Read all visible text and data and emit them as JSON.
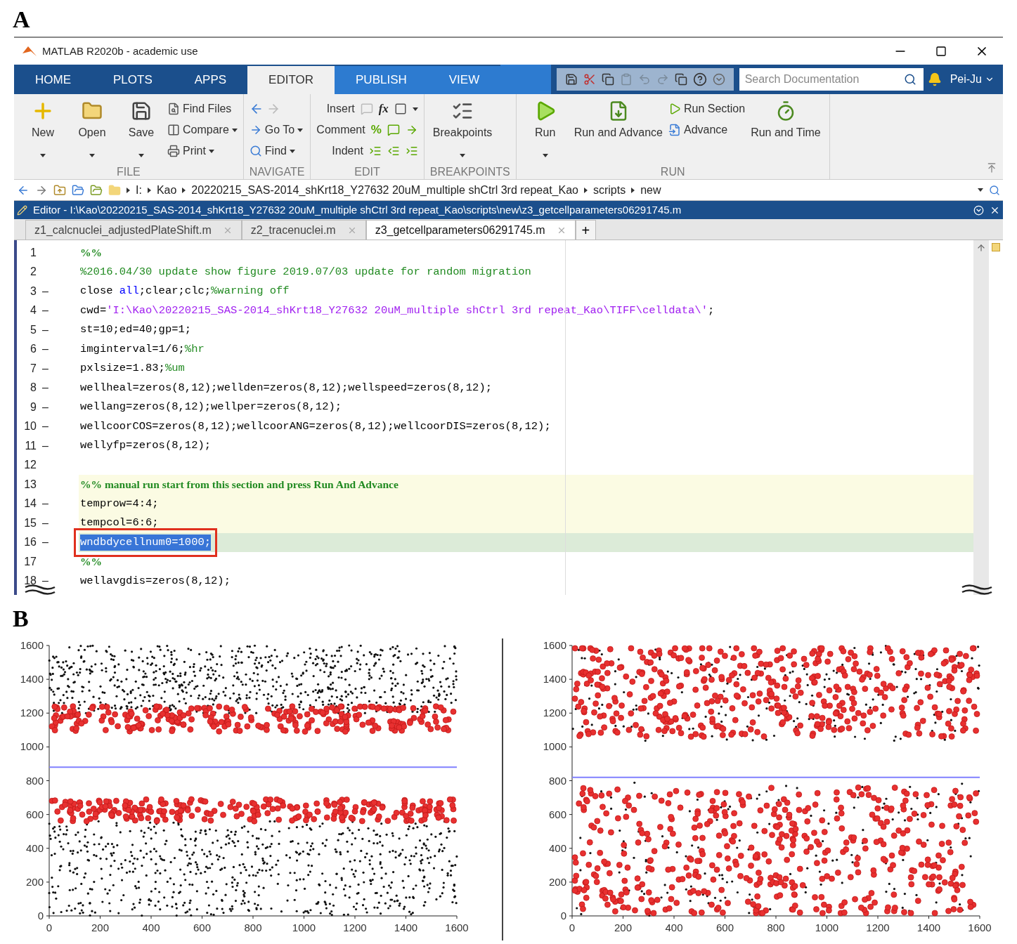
{
  "panel_a": {
    "label": "A"
  },
  "window": {
    "title": "MATLAB R2020b - academic use"
  },
  "tabs": [
    {
      "label": "HOME",
      "selected": false
    },
    {
      "label": "PLOTS",
      "selected": false
    },
    {
      "label": "APPS",
      "selected": false
    },
    {
      "label": "EDITOR",
      "selected": true
    },
    {
      "label": "PUBLISH",
      "selected": false
    },
    {
      "label": "VIEW",
      "selected": false
    }
  ],
  "search": {
    "placeholder": "Search Documentation"
  },
  "user": {
    "name": "Pei-Ju"
  },
  "ribbon": [
    {
      "title": "FILE",
      "columns": [
        {
          "kind": "large",
          "label": "New",
          "dropdown": true
        },
        {
          "kind": "large",
          "label": "Open",
          "dropdown": true
        },
        {
          "kind": "large",
          "label": "Save",
          "dropdown": true
        },
        {
          "kind": "stack",
          "items": [
            {
              "kind": "command",
              "label": "Find Files",
              "dropdown": false
            },
            {
              "kind": "command",
              "label": "Compare",
              "dropdown": true
            },
            {
              "kind": "command",
              "label": "Print",
              "dropdown": true
            }
          ]
        }
      ]
    },
    {
      "title": "NAVIGATE",
      "columns": [
        {
          "kind": "stack",
          "items": [
            {
              "kind": "nav-arrows"
            },
            {
              "kind": "command",
              "label": "Go To",
              "dropdown": true
            },
            {
              "kind": "command",
              "label": "Find",
              "dropdown": true
            }
          ]
        }
      ]
    },
    {
      "title": "EDIT",
      "columns": [
        {
          "kind": "stack",
          "items": [
            {
              "kind": "edit-row",
              "label": "Insert",
              "glyph": "fx",
              "dropdown": true
            },
            {
              "kind": "edit-row",
              "label": "Comment",
              "glyph": "%",
              "dropdown": false
            },
            {
              "kind": "edit-row",
              "label": "Indent",
              "dropdown": false
            }
          ]
        }
      ]
    },
    {
      "title": "BREAKPOINTS",
      "columns": [
        {
          "kind": "large",
          "label": "Breakpoints",
          "dropdown": true
        }
      ]
    },
    {
      "title": "RUN",
      "columns": [
        {
          "kind": "large",
          "label": "Run",
          "dropdown": true
        },
        {
          "kind": "large",
          "label": "Run and Advance",
          "dropdown": false
        },
        {
          "kind": "stack",
          "items": [
            {
              "kind": "command",
              "label": "Run Section",
              "dropdown": false
            },
            {
              "kind": "command",
              "label": "Advance",
              "dropdown": false
            }
          ]
        },
        {
          "kind": "large",
          "label": "Run and Time",
          "dropdown": false
        }
      ]
    }
  ],
  "address_bar": {
    "path": [
      "I:",
      "Kao",
      "20220215_SAS-2014_shKrt18_Y27632 20uM_multiple shCtrl 3rd repeat_Kao",
      "scripts",
      "new"
    ]
  },
  "editor": {
    "title": "Editor - I:\\Kao\\20220215_SAS-2014_shKrt18_Y27632 20uM_multiple shCtrl 3rd repeat_Kao\\scripts\\new\\z3_getcellparameters06291745.m",
    "file_tabs": [
      {
        "label": "z1_calcnuclei_adjustedPlateShift.m",
        "selected": false
      },
      {
        "label": "z2_tracenuclei.m",
        "selected": false
      },
      {
        "label": "z3_getcellparameters06291745.m",
        "selected": true
      }
    ],
    "new_tab": "+",
    "lines": [
      {
        "number": "1",
        "section": false,
        "current": false,
        "segments": [
          {
            "kind": "section",
            "text": "%%"
          }
        ]
      },
      {
        "number": "2",
        "section": false,
        "current": false,
        "segments": [
          {
            "kind": "comment",
            "text": "%2016.04/30 update show figure 2019.07/03 update for random migration"
          }
        ]
      },
      {
        "number": "3",
        "dash": "–",
        "section": false,
        "current": false,
        "segments": [
          {
            "kind": "code",
            "text": "close "
          },
          {
            "kind": "keyword",
            "text": "all"
          },
          {
            "kind": "code",
            "text": ";clear;clc;"
          },
          {
            "kind": "comment",
            "text": "%warning off"
          }
        ]
      },
      {
        "number": "4",
        "dash": "–",
        "section": false,
        "current": false,
        "segments": [
          {
            "kind": "code",
            "text": "cwd="
          },
          {
            "kind": "string",
            "text": "'I:\\Kao\\20220215_SAS-2014_shKrt18_Y27632 20uM_multiple shCtrl 3rd repeat_Kao\\TIFF\\celldata\\'"
          },
          {
            "kind": "code",
            "text": ";"
          }
        ]
      },
      {
        "number": "5",
        "dash": "–",
        "section": false,
        "current": false,
        "segments": [
          {
            "kind": "code",
            "text": "st=10;ed=40;gp=1;"
          }
        ]
      },
      {
        "number": "6",
        "dash": "–",
        "section": false,
        "current": false,
        "segments": [
          {
            "kind": "code",
            "text": "imginterval=1/6;"
          },
          {
            "kind": "comment",
            "text": "%hr"
          }
        ]
      },
      {
        "number": "7",
        "dash": "–",
        "section": false,
        "current": false,
        "segments": [
          {
            "kind": "code",
            "text": "pxlsize=1.83;"
          },
          {
            "kind": "comment",
            "text": "%um"
          }
        ]
      },
      {
        "number": "8",
        "dash": "–",
        "section": false,
        "current": false,
        "segments": [
          {
            "kind": "code",
            "text": "wellheal=zeros(8,12);wellden=zeros(8,12);wellspeed=zeros(8,12);"
          }
        ]
      },
      {
        "number": "9",
        "dash": "–",
        "section": false,
        "current": false,
        "segments": [
          {
            "kind": "code",
            "text": "wellang=zeros(8,12);wellper=zeros(8,12);"
          }
        ]
      },
      {
        "number": "10",
        "dash": "–",
        "section": false,
        "current": false,
        "segments": [
          {
            "kind": "code",
            "text": "wellcoorCOS=zeros(8,12);wellcoorANG=zeros(8,12);wellcoorDIS=zeros(8,12);"
          }
        ]
      },
      {
        "number": "11",
        "dash": "–",
        "section": false,
        "current": false,
        "segments": [
          {
            "kind": "code",
            "text": "wellyfp=zeros(8,12);"
          }
        ]
      },
      {
        "number": "12",
        "section": false,
        "current": false
      },
      {
        "number": "13",
        "section": true,
        "current": false,
        "segments": [
          {
            "kind": "section",
            "text": "%% manual run start from this section and press Run And Advance"
          }
        ]
      },
      {
        "number": "14",
        "dash": "–",
        "section": true,
        "current": false,
        "segments": [
          {
            "kind": "code",
            "text": "temprow=4:4;"
          }
        ]
      },
      {
        "number": "15",
        "dash": "–",
        "section": true,
        "current": false,
        "segments": [
          {
            "kind": "code",
            "text": "tempcol=6:6;"
          }
        ]
      },
      {
        "number": "16",
        "dash": "–",
        "section": true,
        "current": true,
        "segments": [
          {
            "kind": "code",
            "text": "wndbdycellnum0=1000;",
            "selected": true
          }
        ]
      },
      {
        "number": "17",
        "section": false,
        "current": false,
        "segments": [
          {
            "kind": "section",
            "text": "%%"
          }
        ]
      },
      {
        "number": "18",
        "dash": "–",
        "section": false,
        "current": false,
        "segments": [
          {
            "kind": "code",
            "text": "wellavgdis=zeros(8,12);"
          }
        ]
      }
    ]
  },
  "panel_b": {
    "label": "B",
    "plots": [
      {
        "kind": "edge-band",
        "x_ticks": [
          "0",
          "200",
          "400",
          "600",
          "800",
          "1000",
          "1200",
          "1400",
          "1600"
        ],
        "y_ticks": [
          "1600",
          "1400",
          "1200",
          "1000",
          "800",
          "600",
          "400",
          "200",
          "0"
        ]
      },
      {
        "kind": "mixed",
        "x_ticks": [
          "0",
          "200",
          "400",
          "600",
          "800",
          "1000",
          "1200",
          "1400",
          "1600"
        ],
        "y_ticks": [
          "1600",
          "1400",
          "1200",
          "1000",
          "800",
          "600",
          "400",
          "200",
          "0"
        ]
      }
    ]
  }
}
